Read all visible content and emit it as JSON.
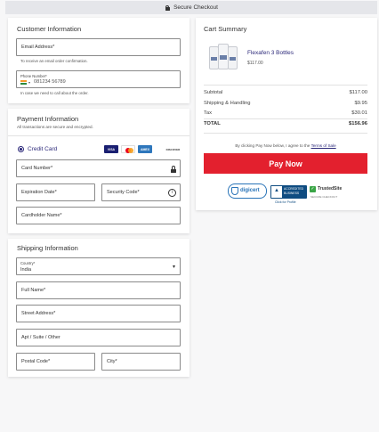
{
  "header": {
    "title": "Secure Checkout",
    "icon": "lock-icon"
  },
  "customer": {
    "title": "Customer Information",
    "email_label": "Email Address*",
    "email_helper": "To receive an email order confirmation.",
    "phone_label": "Phone Number*",
    "phone_flag": "India",
    "phone_placeholder": "081234 56789",
    "phone_helper": "In case we need to call about the order."
  },
  "payment": {
    "title": "Payment Information",
    "subtitle": "All transactions are secure and encrypted.",
    "method_label": "Credit Card",
    "card_brands": [
      "VISA",
      "Mastercard",
      "AMEX",
      "Discover"
    ],
    "card_brand_labels": {
      "visa": "VISA",
      "amex": "AMEX",
      "discover": "DISCOVER"
    },
    "card_number_label": "Card Number*",
    "expiration_label": "Expiration Date*",
    "security_label": "Security Code*",
    "cardholder_label": "Cardholder Name*"
  },
  "shipping": {
    "title": "Shipping Information",
    "country_label": "Country*",
    "country_value": "India",
    "full_name_label": "Full Name*",
    "street_label": "Street Address*",
    "apt_label": "Apt / Suite / Other",
    "postal_label": "Postal Code*",
    "city_label": "City*"
  },
  "summary": {
    "title": "Cart Summary",
    "product_name": "Flexafen 3 Bottles",
    "product_price": "$117.00",
    "rows": [
      {
        "label": "Subtotal",
        "value": "$117.00"
      },
      {
        "label": "Shipping & Handling",
        "value": "$9.95"
      },
      {
        "label": "Tax",
        "value": "$30.01"
      },
      {
        "label": "TOTAL",
        "value": "$156.96"
      }
    ],
    "terms_prefix": "By clicking Pay Now below, I agree to the",
    "terms_link": "Terms of Sale",
    "pay_button": "Pay Now",
    "badges": {
      "digicert": "digicert",
      "bbb_line1": "ACCREDITED",
      "bbb_line2": "BUSINESS",
      "bbb_line3": "Click for Profile",
      "trustedsite_line1": "TrustedSite",
      "trustedsite_line2": "SECURE CHECKOUT"
    }
  },
  "colors": {
    "accent": "#2d2a7a",
    "pay": "#e3202e",
    "bbb": "#0f4c81"
  }
}
